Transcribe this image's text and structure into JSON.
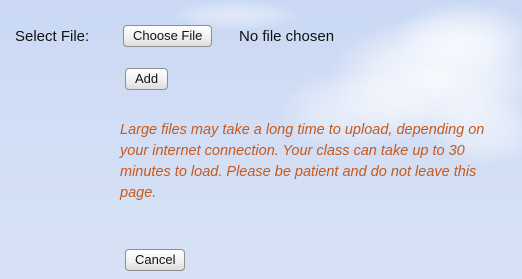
{
  "upload_form": {
    "select_label": "Select File:",
    "choose_file_label": "Choose File",
    "file_status": "No file chosen",
    "add_label": "Add",
    "warning_text": "Large files may take a long time to upload, depending on your internet connection. Your class can take up to 30 minutes to load. Please be patient and do not leave this page.",
    "cancel_label": "Cancel"
  },
  "colors": {
    "background": "#cfdcf4",
    "warning_text": "#c8591c"
  }
}
